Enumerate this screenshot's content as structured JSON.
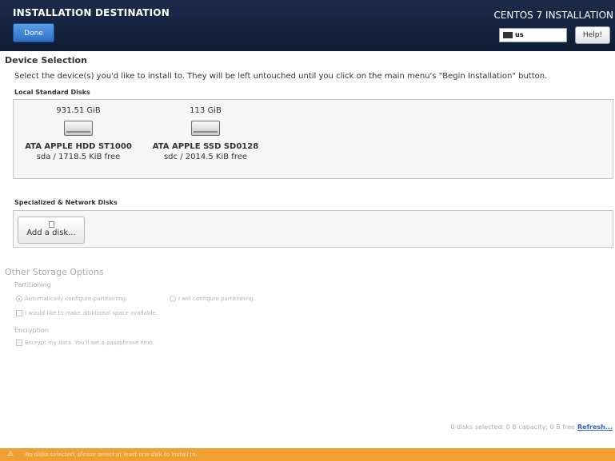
{
  "header": {
    "title": "INSTALLATION DESTINATION",
    "done_label": "Done",
    "product": "CENTOS 7 INSTALLATION",
    "keyboard_layout": "us",
    "help_label": "Help!"
  },
  "device_selection": {
    "title": "Device Selection",
    "intro": "Select the device(s) you'd like to install to.  They will be left untouched until you click on the main menu's \"Begin Installation\" button.",
    "local_title": "Local Standard Disks",
    "disks": [
      {
        "capacity": "931.51 GiB",
        "name": "ATA APPLE HDD ST1000",
        "free": "sda  /  1718.5 KiB free",
        "icon": "hard-disk-icon"
      },
      {
        "capacity": "113 GiB",
        "name": "ATA APPLE SSD SD0128",
        "free": "sdc  /  2014.5 KiB free",
        "icon": "hard-disk-icon"
      }
    ],
    "specialized_title": "Specialized & Network Disks",
    "add_disk_label": "Add a disk..."
  },
  "other_storage": {
    "title": "Other Storage Options",
    "partitioning_label": "Partitioning",
    "auto_partition": "Automatically configure partitioning.",
    "manual_partition": "I will configure partitioning.",
    "additional_space": "I would like to make additional space available.",
    "encryption_label": "Encryption",
    "encrypt_data": "Encrypt my data. You'll set a passphrase next."
  },
  "footer": {
    "summary": "0 disks selected; 0 B capacity; 0 B free",
    "refresh_label": "Refresh...",
    "warning": "No disks selected; please select at least one disk to install to."
  },
  "colors": {
    "header_bg": "#14243f",
    "done_button": "#3b82d6",
    "warning_bar": "#f0a030",
    "link": "#2a64c4"
  }
}
